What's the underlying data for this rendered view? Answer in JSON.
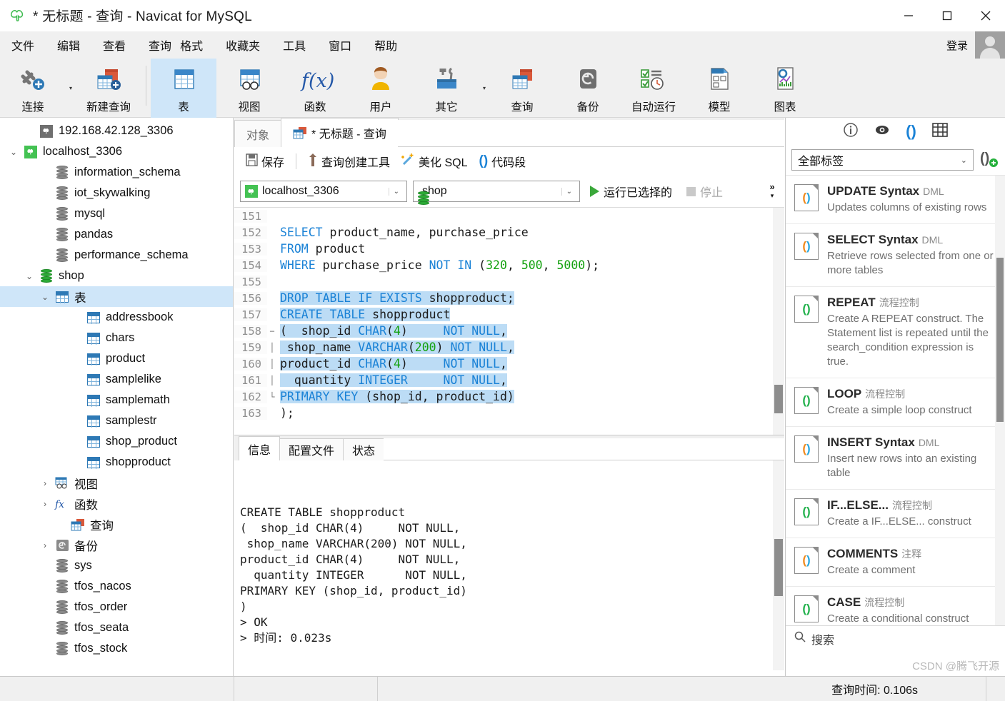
{
  "window": {
    "title": "* 无标题 - 查询 - Navicat for MySQL",
    "logo_icon": "navicat-dolphin-logo",
    "minimize_label": "—",
    "maximize_label": "❐",
    "close_label": "✕"
  },
  "menubar": {
    "items": [
      {
        "label": "文件",
        "name": "menu-file"
      },
      {
        "label": "编辑",
        "name": "menu-edit"
      },
      {
        "label": "查看",
        "name": "menu-view"
      },
      {
        "label": "查询",
        "name": "menu-query"
      },
      {
        "label": "格式",
        "name": "menu-format"
      },
      {
        "label": "收藏夹",
        "name": "menu-favorites"
      },
      {
        "label": "工具",
        "name": "menu-tools"
      },
      {
        "label": "窗口",
        "name": "menu-window"
      },
      {
        "label": "帮助",
        "name": "menu-help"
      }
    ],
    "login_label": "登录"
  },
  "toolbar": {
    "buttons": [
      {
        "label": "连接",
        "icon": "connection-plug-icon",
        "selected": false,
        "caret": true
      },
      {
        "label": "新建查询",
        "icon": "new-query-icon",
        "selected": false,
        "caret": false
      },
      {
        "label": "表",
        "icon": "table-icon",
        "selected": true,
        "caret": false
      },
      {
        "label": "视图",
        "icon": "view-icon",
        "selected": false,
        "caret": false
      },
      {
        "label": "函数",
        "icon": "function-fx-icon",
        "selected": false,
        "caret": false
      },
      {
        "label": "用户",
        "icon": "user-icon",
        "selected": false,
        "caret": false
      },
      {
        "label": "其它",
        "icon": "other-tools-icon",
        "selected": false,
        "caret": true
      },
      {
        "label": "查询",
        "icon": "query-icon",
        "selected": false,
        "caret": false
      },
      {
        "label": "备份",
        "icon": "backup-icon",
        "selected": false,
        "caret": false
      },
      {
        "label": "自动运行",
        "icon": "automation-icon",
        "selected": false,
        "caret": false
      },
      {
        "label": "模型",
        "icon": "model-icon",
        "selected": false,
        "caret": false
      },
      {
        "label": "图表",
        "icon": "chart-icon",
        "selected": false,
        "caret": false
      }
    ]
  },
  "sidebar": {
    "nodes": [
      {
        "label": "192.168.42.128_3306",
        "icon": "connection-icon",
        "indent": 1,
        "twist": "",
        "selected": false
      },
      {
        "label": "localhost_3306",
        "icon": "connection-icon-active",
        "indent": 0,
        "twist": "v",
        "selected": false
      },
      {
        "label": "information_schema",
        "icon": "database-icon",
        "indent": 2,
        "twist": "",
        "selected": false
      },
      {
        "label": "iot_skywalking",
        "icon": "database-icon",
        "indent": 2,
        "twist": "",
        "selected": false
      },
      {
        "label": "mysql",
        "icon": "database-icon",
        "indent": 2,
        "twist": "",
        "selected": false
      },
      {
        "label": "pandas",
        "icon": "database-icon",
        "indent": 2,
        "twist": "",
        "selected": false
      },
      {
        "label": "performance_schema",
        "icon": "database-icon",
        "indent": 2,
        "twist": "",
        "selected": false
      },
      {
        "label": "shop",
        "icon": "database-icon-active",
        "indent": 1,
        "twist": "v",
        "selected": false
      },
      {
        "label": "表",
        "icon": "table-group-icon",
        "indent": 2,
        "twist": "v",
        "selected": true
      },
      {
        "label": "addressbook",
        "icon": "table-icon",
        "indent": 4,
        "twist": "",
        "selected": false
      },
      {
        "label": "chars",
        "icon": "table-icon",
        "indent": 4,
        "twist": "",
        "selected": false
      },
      {
        "label": "product",
        "icon": "table-icon",
        "indent": 4,
        "twist": "",
        "selected": false
      },
      {
        "label": "samplelike",
        "icon": "table-icon",
        "indent": 4,
        "twist": "",
        "selected": false
      },
      {
        "label": "samplemath",
        "icon": "table-icon",
        "indent": 4,
        "twist": "",
        "selected": false
      },
      {
        "label": "samplestr",
        "icon": "table-icon",
        "indent": 4,
        "twist": "",
        "selected": false
      },
      {
        "label": "shop_product",
        "icon": "table-icon",
        "indent": 4,
        "twist": "",
        "selected": false
      },
      {
        "label": "shopproduct",
        "icon": "table-icon",
        "indent": 4,
        "twist": "",
        "selected": false
      },
      {
        "label": "视图",
        "icon": "view-group-icon",
        "indent": 2,
        "twist": ">",
        "selected": false
      },
      {
        "label": "函数",
        "icon": "function-group-icon",
        "indent": 2,
        "twist": ">",
        "selected": false
      },
      {
        "label": "查询",
        "icon": "query-group-icon",
        "indent": 3,
        "twist": "",
        "selected": false
      },
      {
        "label": "备份",
        "icon": "backup-group-icon",
        "indent": 2,
        "twist": ">",
        "selected": false
      },
      {
        "label": "sys",
        "icon": "database-icon",
        "indent": 2,
        "twist": "",
        "selected": false
      },
      {
        "label": "tfos_nacos",
        "icon": "database-icon",
        "indent": 2,
        "twist": "",
        "selected": false
      },
      {
        "label": "tfos_order",
        "icon": "database-icon",
        "indent": 2,
        "twist": "",
        "selected": false
      },
      {
        "label": "tfos_seata",
        "icon": "database-icon",
        "indent": 2,
        "twist": "",
        "selected": false
      },
      {
        "label": "tfos_stock",
        "icon": "database-icon",
        "indent": 2,
        "twist": "",
        "selected": false
      }
    ]
  },
  "center": {
    "doc_tabs": [
      {
        "label": "对象",
        "active": false,
        "icon": ""
      },
      {
        "label": "* 无标题 - 查询",
        "active": true,
        "icon": "query-doc-icon"
      }
    ],
    "query_toolbar": {
      "save_label": "保存",
      "save_icon": "save-icon",
      "builder_label": "查询创建工具",
      "builder_icon": "query-builder-icon",
      "beautify_label": "美化 SQL",
      "beautify_icon": "magic-wand-icon",
      "snippet_label": "代码段",
      "snippet_icon": "code-snippet-icon"
    },
    "connection_select": {
      "value": "localhost_3306",
      "icon": "connection-icon-active"
    },
    "database_select": {
      "value": "shop",
      "icon": "database-icon-active"
    },
    "run_label": "运行已选择的",
    "stop_label": "停止",
    "overflow_label": "»",
    "editor": {
      "lines": [
        {
          "no": "151",
          "fold": "",
          "tokens": []
        },
        {
          "no": "152",
          "fold": "",
          "tokens": [
            {
              "t": "SELECT",
              "c": "kw"
            },
            {
              "t": " product_name, purchase_price",
              "c": "pl"
            }
          ]
        },
        {
          "no": "153",
          "fold": "",
          "tokens": [
            {
              "t": "FROM",
              "c": "kw"
            },
            {
              "t": " product",
              "c": "pl"
            }
          ]
        },
        {
          "no": "154",
          "fold": "",
          "tokens": [
            {
              "t": "WHERE",
              "c": "kw"
            },
            {
              "t": " purchase_price ",
              "c": "pl"
            },
            {
              "t": "NOT",
              "c": "kw"
            },
            {
              "t": " ",
              "c": "pl"
            },
            {
              "t": "IN",
              "c": "kw"
            },
            {
              "t": " (",
              "c": "pl"
            },
            {
              "t": "320",
              "c": "num"
            },
            {
              "t": ", ",
              "c": "pl"
            },
            {
              "t": "500",
              "c": "num"
            },
            {
              "t": ", ",
              "c": "pl"
            },
            {
              "t": "5000",
              "c": "num"
            },
            {
              "t": ");",
              "c": "pl"
            }
          ]
        },
        {
          "no": "155",
          "fold": "",
          "tokens": []
        },
        {
          "no": "156",
          "fold": "",
          "tokens": [
            {
              "t": "DROP TABLE IF EXISTS",
              "c": "kw hl"
            },
            {
              "t": " shopproduct;",
              "c": "pl hl"
            }
          ]
        },
        {
          "no": "157",
          "fold": "",
          "tokens": [
            {
              "t": "CREATE TABLE",
              "c": "kw hl"
            },
            {
              "t": " shopproduct",
              "c": "pl hl"
            }
          ]
        },
        {
          "no": "158",
          "fold": "−",
          "tokens": [
            {
              "t": "(  shop_id ",
              "c": "pl hl"
            },
            {
              "t": "CHAR",
              "c": "kw hl"
            },
            {
              "t": "(",
              "c": "pl hl"
            },
            {
              "t": "4",
              "c": "num hl"
            },
            {
              "t": ")     ",
              "c": "pl hl"
            },
            {
              "t": "NOT NULL",
              "c": "kw hl"
            },
            {
              "t": ",",
              "c": "pl hl"
            }
          ]
        },
        {
          "no": "159",
          "fold": "│",
          "tokens": [
            {
              "t": " shop_name ",
              "c": "pl hl"
            },
            {
              "t": "VARCHAR",
              "c": "kw hl"
            },
            {
              "t": "(",
              "c": "pl hl"
            },
            {
              "t": "200",
              "c": "num hl"
            },
            {
              "t": ") ",
              "c": "pl hl"
            },
            {
              "t": "NOT NULL",
              "c": "kw hl"
            },
            {
              "t": ",",
              "c": "pl hl"
            }
          ]
        },
        {
          "no": "160",
          "fold": "│",
          "tokens": [
            {
              "t": "product_id ",
              "c": "pl hl"
            },
            {
              "t": "CHAR",
              "c": "kw hl"
            },
            {
              "t": "(",
              "c": "pl hl"
            },
            {
              "t": "4",
              "c": "num hl"
            },
            {
              "t": ")     ",
              "c": "pl hl"
            },
            {
              "t": "NOT NULL",
              "c": "kw hl"
            },
            {
              "t": ",",
              "c": "pl hl"
            }
          ]
        },
        {
          "no": "161",
          "fold": "│",
          "tokens": [
            {
              "t": "  quantity ",
              "c": "pl hl"
            },
            {
              "t": "INTEGER",
              "c": "kw hl"
            },
            {
              "t": "     ",
              "c": "pl hl"
            },
            {
              "t": "NOT NULL",
              "c": "kw hl"
            },
            {
              "t": ",",
              "c": "pl hl"
            }
          ]
        },
        {
          "no": "162",
          "fold": "└",
          "tokens": [
            {
              "t": "PRIMARY KEY",
              "c": "kw hl"
            },
            {
              "t": " (shop_id, product_id)",
              "c": "pl hl"
            }
          ]
        },
        {
          "no": "163",
          "fold": "",
          "tokens": [
            {
              "t": ");",
              "c": "pl"
            }
          ]
        }
      ]
    },
    "result_tabs": [
      {
        "label": "信息",
        "active": true
      },
      {
        "label": "配置文件",
        "active": false
      },
      {
        "label": "状态",
        "active": false
      }
    ],
    "result_text": "CREATE TABLE shopproduct\n(  shop_id CHAR(4)     NOT NULL,\n shop_name VARCHAR(200) NOT NULL,\nproduct_id CHAR(4)     NOT NULL,\n  quantity INTEGER      NOT NULL,\nPRIMARY KEY (shop_id, product_id)\n)\n> OK\n> 时间: 0.023s"
  },
  "right_panel": {
    "icons": [
      {
        "name": "info-icon",
        "glyph": "ⓘ"
      },
      {
        "name": "eye-icon",
        "glyph": "◉"
      },
      {
        "name": "snippet-icon",
        "glyph": "()"
      },
      {
        "name": "grid-icon",
        "glyph": "▦"
      }
    ],
    "filter_value": "全部标签",
    "add_snippet_icon": "add-snippet-icon",
    "snippets": [
      {
        "title": "CASE",
        "category": "流程控制",
        "desc": "Create a conditional construct",
        "icon_color": "#22b14c"
      },
      {
        "title": "COMMENTS",
        "category": "注释",
        "desc": "Create a comment",
        "icon_color": "#f08a1e"
      },
      {
        "title": "IF...ELSE...",
        "category": "流程控制",
        "desc": "Create a IF...ELSE... construct",
        "icon_color": "#22b14c"
      },
      {
        "title": "INSERT Syntax",
        "category": "DML",
        "desc": "Insert new rows into an existing table",
        "icon_color": "#f08a1e"
      },
      {
        "title": "LOOP",
        "category": "流程控制",
        "desc": "Create a simple loop construct",
        "icon_color": "#22b14c"
      },
      {
        "title": "REPEAT",
        "category": "流程控制",
        "desc": "Create A REPEAT construct. The Statement list is repeated until the search_condition expression is true.",
        "icon_color": "#22b14c"
      },
      {
        "title": "SELECT Syntax",
        "category": "DML",
        "desc": "Retrieve rows selected from one or more tables",
        "icon_color": "#f08a1e"
      },
      {
        "title": "UPDATE Syntax",
        "category": "DML",
        "desc": "Updates columns of existing rows",
        "icon_color": "#f08a1e"
      }
    ],
    "search_placeholder": "搜索",
    "search_icon": "search-icon",
    "watermark": "CSDN @腾飞开源"
  },
  "statusbar": {
    "query_time": "查询时间: 0.106s"
  },
  "colors": {
    "accent_blue": "#1a82d6",
    "selection": "#cfe6f9",
    "keyword": "#1a82d6",
    "number": "#13a10e",
    "green": "#2cab36"
  }
}
